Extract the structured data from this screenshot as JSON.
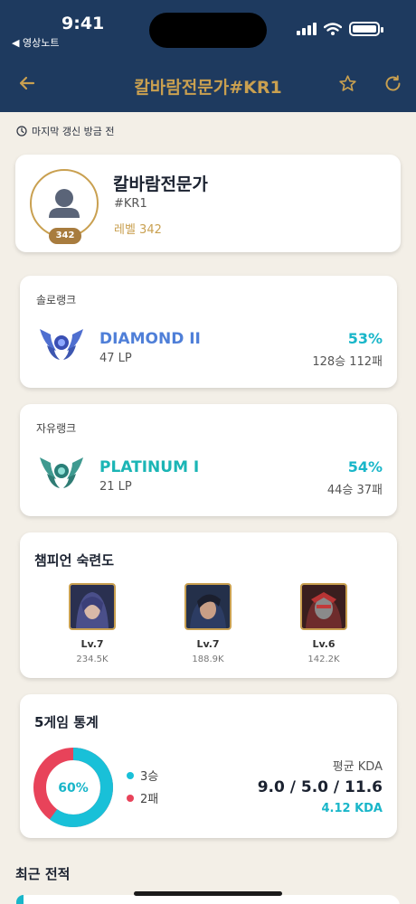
{
  "status_bar": {
    "time": "9:41",
    "back_app": "◀ 영상노트"
  },
  "nav": {
    "title": "칼바람전문가#KR1",
    "back_icon": "arrow-left-icon",
    "favorite_icon": "star-icon",
    "refresh_icon": "refresh-icon"
  },
  "updated": "마지막 갱신 방금 전",
  "profile": {
    "name": "칼바람전문가",
    "tag": "#KR1",
    "level_text": "레벨 342",
    "level_badge": "342"
  },
  "solo_rank": {
    "label": "솔로랭크",
    "tier": "DIAMOND II",
    "lp": "47 LP",
    "winrate": "53%",
    "record": "128승 112패",
    "tier_color": "#4f7fd8"
  },
  "flex_rank": {
    "label": "자유랭크",
    "tier": "PLATINUM I",
    "lp": "21 LP",
    "winrate": "54%",
    "record": "44승 37패",
    "tier_color": "#1bb5b5"
  },
  "mastery": {
    "title": "챔피언 숙련도",
    "champions": [
      {
        "level": "Lv.7",
        "points": "234.5K"
      },
      {
        "level": "Lv.7",
        "points": "188.9K"
      },
      {
        "level": "Lv.6",
        "points": "142.2K"
      }
    ]
  },
  "stats": {
    "title": "5게임 통계",
    "winrate_label": "60%",
    "win_fraction": 0.6,
    "wins_label": "3승",
    "losses_label": "2패",
    "kda_label": "평균 KDA",
    "kda": "9.0 / 5.0 / 11.6",
    "kda_ratio": "4.12 KDA",
    "colors": {
      "win": "#19c0d8",
      "loss": "#e8435a"
    }
  },
  "recent": {
    "title": "최근 전적"
  }
}
